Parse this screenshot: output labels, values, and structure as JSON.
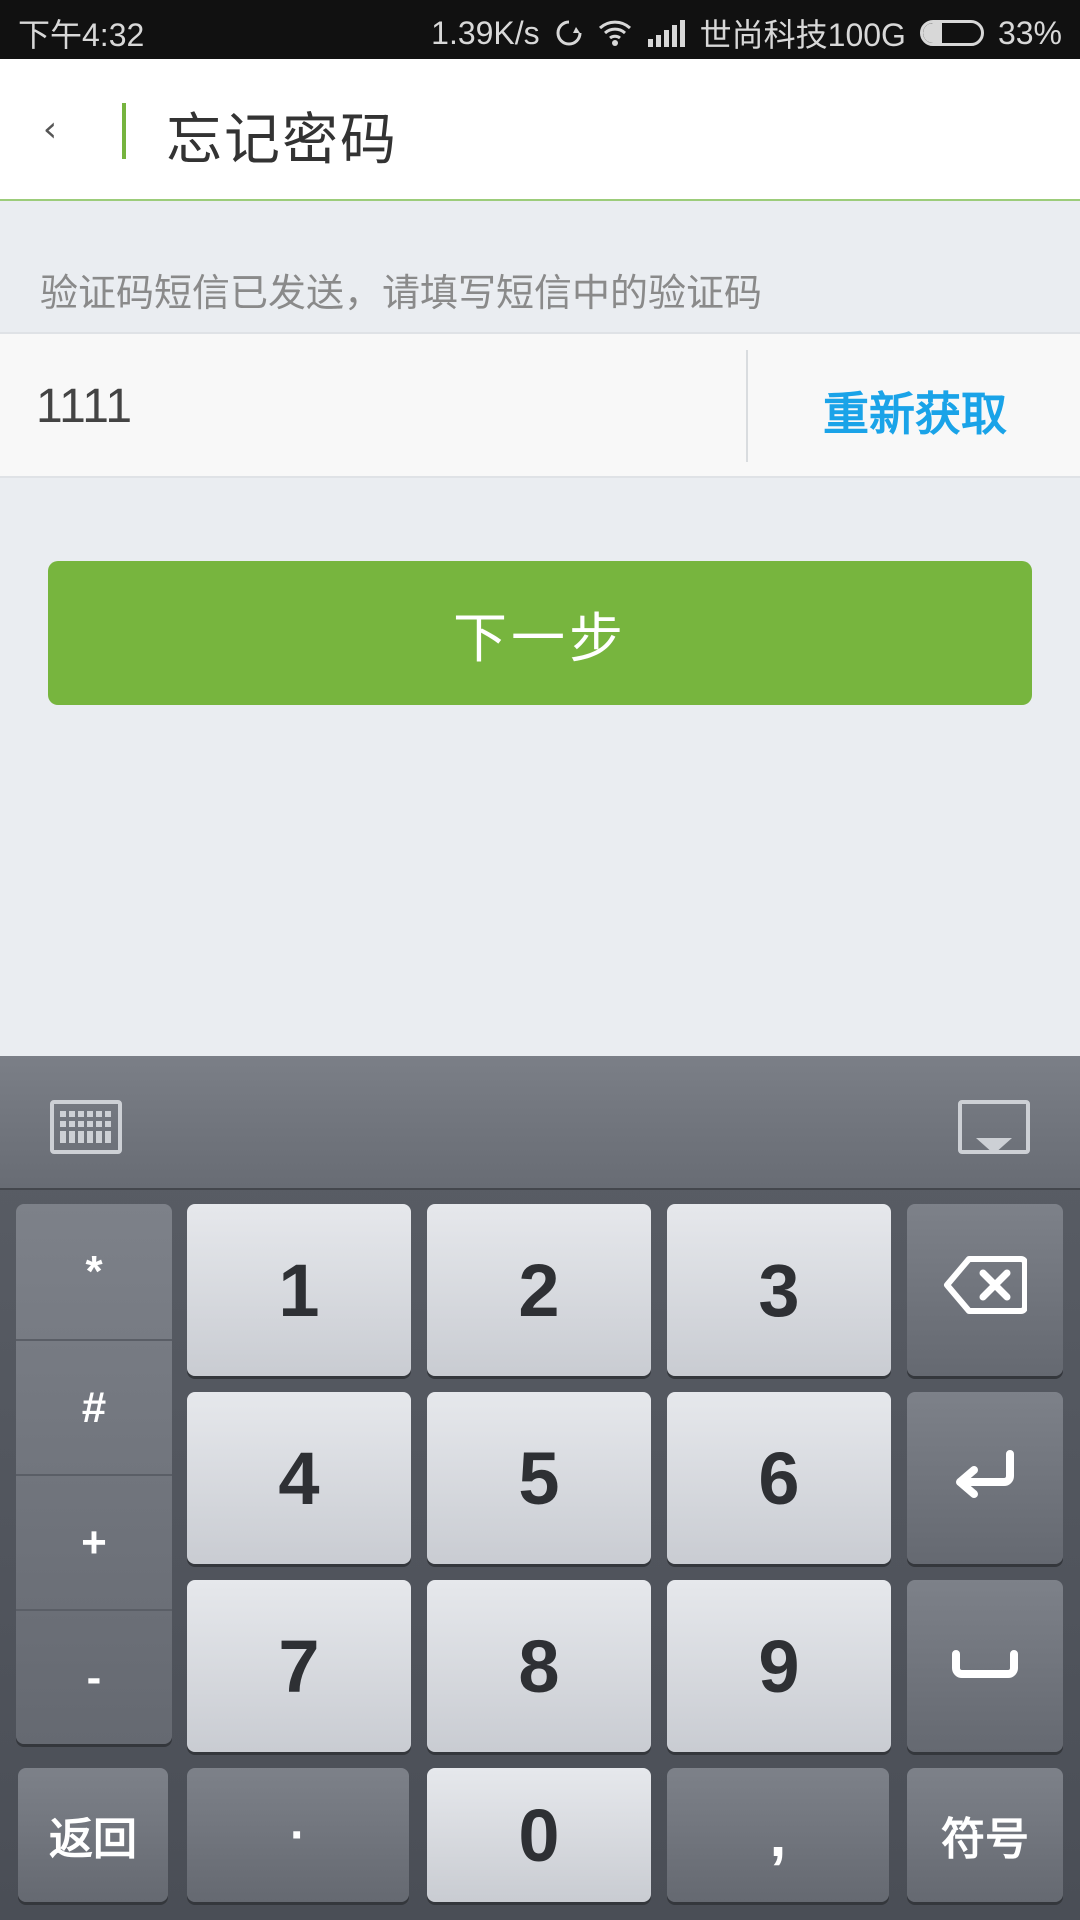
{
  "status_bar": {
    "time": "下午4:32",
    "net_speed": "1.39K/s",
    "carrier": "世尚科技100G",
    "battery_text": "33%",
    "battery_level": 0.33,
    "icons": [
      "sync-icon",
      "wifi-icon",
      "signal-icon",
      "battery-icon"
    ]
  },
  "header": {
    "back_glyph": "‹",
    "title": "忘记密码",
    "accent_color": "#76b43e"
  },
  "hint_text": "验证码短信已发送，请填写短信中的验证码",
  "code_field": {
    "value": "1111"
  },
  "resend_label": "重新获取",
  "next_button_label": "下一步",
  "keyboard": {
    "toolbar_icons": [
      "keyboard-switch-icon",
      "keyboard-hide-icon"
    ],
    "symbol_keys": [
      "*",
      "#",
      "+",
      "-"
    ],
    "digits": [
      "1",
      "2",
      "3",
      "4",
      "5",
      "6",
      "7",
      "8",
      "9",
      "0"
    ],
    "dot_key": "·",
    "comma_key": ",",
    "back_key": "返回",
    "symbols_key": "符号",
    "icons": [
      "backspace-icon",
      "enter-icon",
      "space-icon"
    ]
  }
}
